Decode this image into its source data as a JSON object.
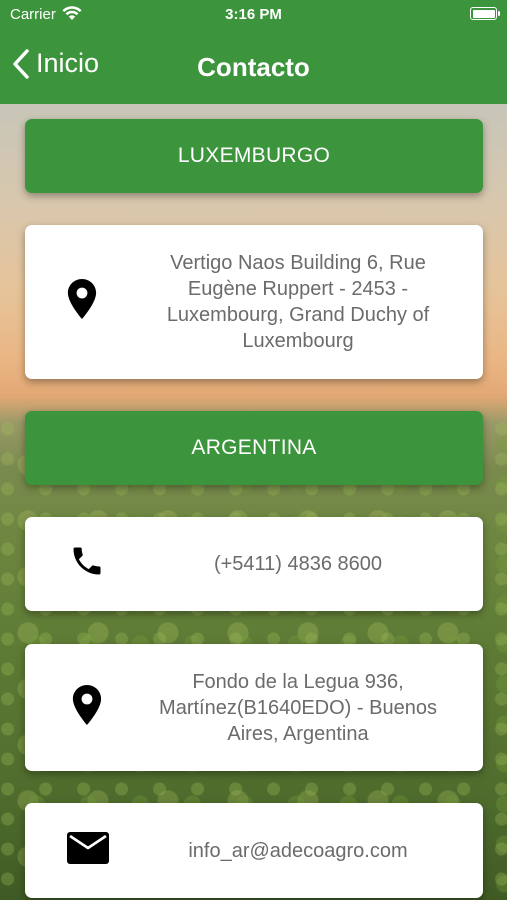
{
  "status_bar": {
    "carrier": "Carrier",
    "time": "3:16 PM"
  },
  "nav": {
    "back_label": "Inicio",
    "title": "Contacto"
  },
  "sections": {
    "luxemburgo": {
      "header": "LUXEMBURGO",
      "address": "Vertigo Naos Building 6, Rue Eugène Ruppert - 2453 - Luxembourg, Grand Duchy of Luxembourg"
    },
    "argentina": {
      "header": "ARGENTINA",
      "phone": "(+5411) 4836 8600",
      "address": "Fondo de la Legua 936, Martínez(B1640EDO) - Buenos Aires, Argentina",
      "email": "info_ar@adecoagro.com"
    }
  },
  "colors": {
    "brand_green": "#3c943c",
    "card_text": "#6b6b6b"
  },
  "icons": {
    "back": "chevron-left-icon",
    "location": "location-pin-icon",
    "phone": "phone-icon",
    "email": "mail-icon"
  }
}
